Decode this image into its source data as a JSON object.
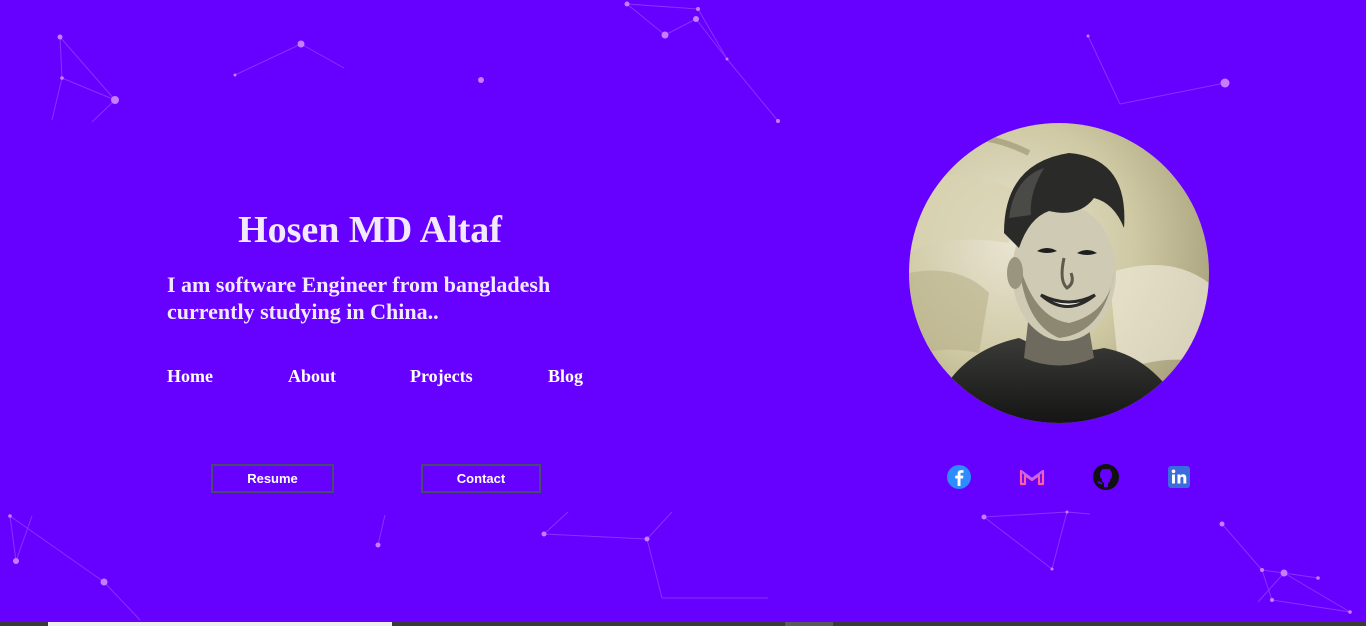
{
  "profile": {
    "name": "Hosen MD Altaf",
    "tagline": "I am software Engineer from bangladesh currently studying in China.."
  },
  "nav": {
    "items": [
      {
        "label": "Home"
      },
      {
        "label": "About"
      },
      {
        "label": "Projects"
      },
      {
        "label": "Blog"
      }
    ]
  },
  "buttons": {
    "resume_label": "Resume",
    "contact_label": "Contact"
  },
  "social": {
    "icons": [
      "facebook-icon",
      "gmail-icon",
      "github-icon",
      "linkedin-icon"
    ]
  },
  "colors": {
    "background": "#6600ff",
    "heading_text": "#f2e9ff",
    "particle": "#c77dff",
    "button_border": "#4a4a6a"
  }
}
